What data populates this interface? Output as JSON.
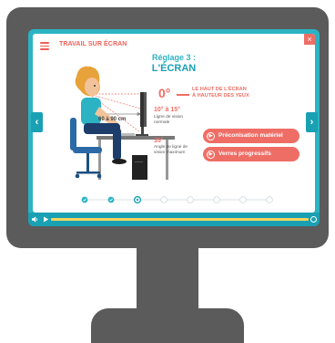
{
  "app": {
    "title": "TRAVAIL SUR ÉCRAN",
    "close_glyph": "×"
  },
  "slide": {
    "step_title": "Réglage 3 :",
    "step_subtitle": "L'ÉCRAN",
    "zero_deg": "0°",
    "zero_deg_text_1": "LE HAUT DE L'ÉCRAN",
    "zero_deg_text_2": "À HAUTEUR DES YEUX",
    "angle_normal": "10° à 15°",
    "angle_normal_desc_1": "Ligne de vision",
    "angle_normal_desc_2": "normale",
    "angle_max": "35°",
    "angle_max_desc_1": "Angle de ligne de",
    "angle_max_desc_2": "vision maximum",
    "distance": "60 à 90 cm"
  },
  "buttons": {
    "recommendation": "Préconisation matériel",
    "progressive_lenses": "Verres progressifs",
    "play_glyph": "▶"
  },
  "navigation": {
    "prev_glyph": "‹",
    "next_glyph": "›"
  },
  "progress": {
    "total_steps": 8,
    "current_step": 3,
    "completed_steps": 2
  },
  "player": {
    "progress_fraction": 1.0
  },
  "colors": {
    "teal": "#2bb3c3",
    "teal_dark": "#1aa0b3",
    "coral": "#ee6e66",
    "track": "#f3d45b",
    "monitor": "#5b5b5b"
  }
}
